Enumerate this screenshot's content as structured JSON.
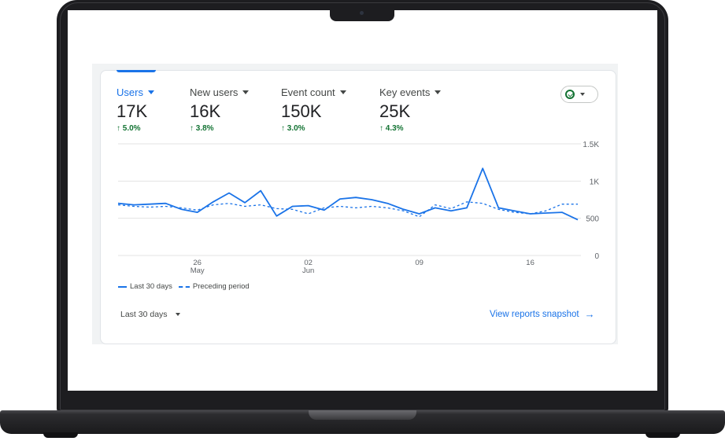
{
  "metrics": [
    {
      "name": "Users",
      "value": "17K",
      "change": "5.0%",
      "active": true
    },
    {
      "name": "New users",
      "value": "16K",
      "change": "3.8%",
      "active": false
    },
    {
      "name": "Event count",
      "value": "150K",
      "change": "3.0%",
      "active": false
    },
    {
      "name": "Key events",
      "value": "25K",
      "change": "4.3%",
      "active": false
    }
  ],
  "status_icon": "check-circle-icon",
  "legend": {
    "current": "Last 30 days",
    "previous": "Preceding period"
  },
  "range_selector": {
    "label": "Last 30 days"
  },
  "snapshot_link": {
    "label": "View reports snapshot",
    "icon": "arrow-right-icon"
  },
  "colors": {
    "accent": "#1a73e8",
    "positive": "#137333",
    "text": "#202124"
  },
  "chart_data": {
    "type": "line",
    "x_tick_labels": [
      {
        "day": "26",
        "month": "May"
      },
      {
        "day": "02",
        "month": "Jun"
      },
      {
        "day": "09",
        "month": ""
      },
      {
        "day": "16",
        "month": ""
      }
    ],
    "y_tick_labels": [
      "1.5K",
      "1K",
      "500",
      "0"
    ],
    "ylim": [
      0,
      1500
    ],
    "grid": true,
    "legend_position": "bottom-left",
    "series": [
      {
        "name": "Last 30 days",
        "style": "solid",
        "values": [
          700,
          680,
          690,
          700,
          620,
          580,
          720,
          840,
          710,
          870,
          530,
          660,
          670,
          610,
          760,
          780,
          750,
          700,
          620,
          560,
          640,
          600,
          640,
          1170,
          640,
          600,
          560,
          570,
          580,
          480
        ]
      },
      {
        "name": "Preceding period",
        "style": "dashed",
        "values": [
          680,
          660,
          650,
          660,
          640,
          610,
          680,
          700,
          660,
          680,
          630,
          620,
          560,
          640,
          660,
          640,
          660,
          640,
          600,
          520,
          680,
          630,
          720,
          700,
          620,
          580,
          560,
          600,
          690,
          690
        ]
      }
    ]
  }
}
